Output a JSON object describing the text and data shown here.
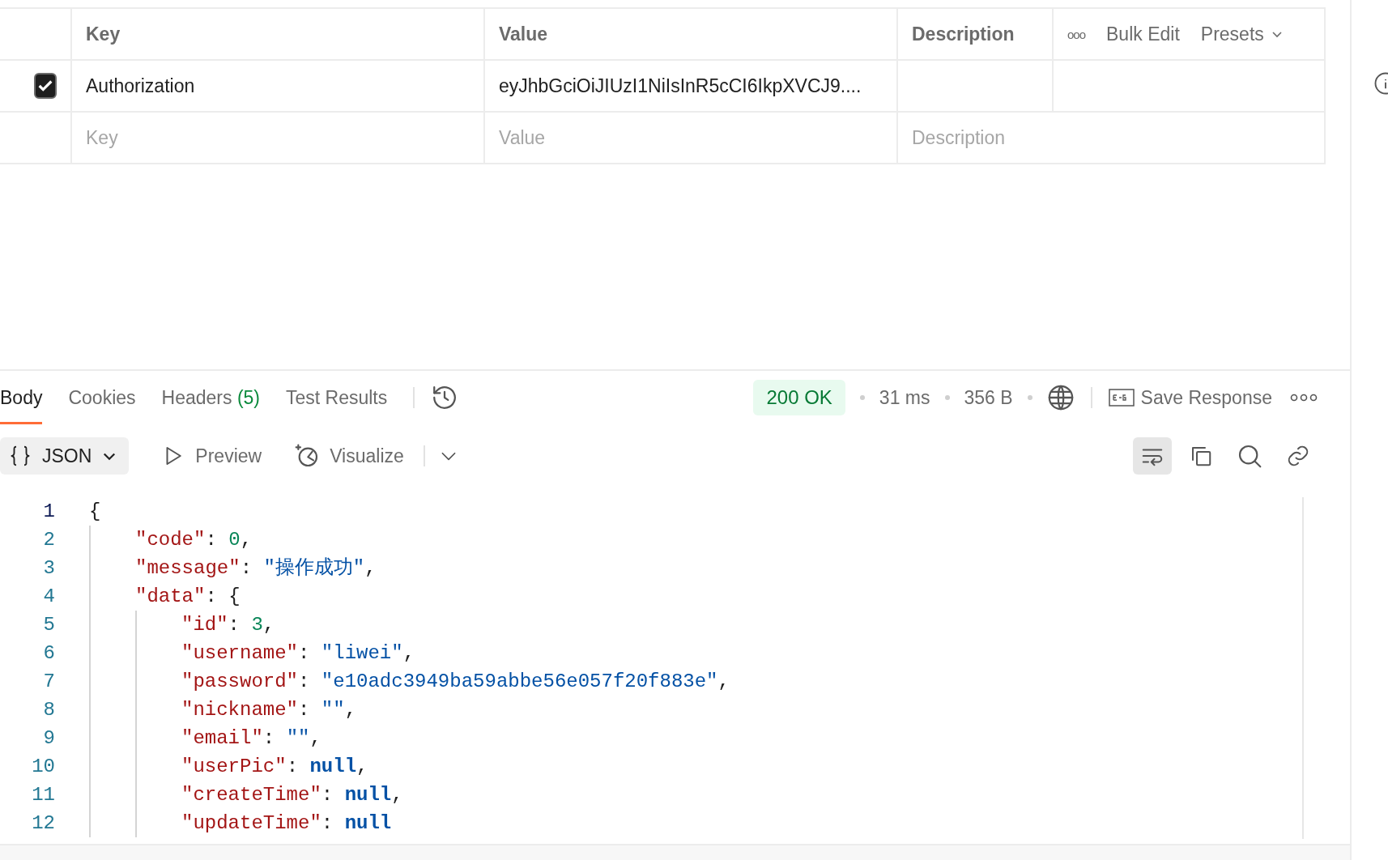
{
  "params_table": {
    "columns": [
      "Key",
      "Value",
      "Description"
    ],
    "actions": {
      "more": "ooo",
      "bulk_edit": "Bulk Edit",
      "presets": "Presets"
    },
    "rows": [
      {
        "checked": true,
        "key": "Authorization",
        "value": "eyJhbGciOiJIUzI1NiIsInR5cCI6IkpXVCJ9...."
      }
    ],
    "new_row": {
      "key_placeholder": "Key",
      "value_placeholder": "Value",
      "description_placeholder": "Description"
    }
  },
  "response": {
    "tabs": [
      {
        "label": "Body",
        "selected": true
      },
      {
        "label": "Cookies",
        "selected": false
      },
      {
        "label": "Headers",
        "count": "(5)",
        "selected": false
      },
      {
        "label": "Test Results",
        "selected": false
      }
    ],
    "status": "200 OK",
    "time": "31 ms",
    "size": "356 B",
    "save_label": "Save Response",
    "format": "JSON",
    "views": [
      {
        "kind": "preview",
        "label": "Preview"
      },
      {
        "kind": "visualize",
        "label": "Visualize"
      }
    ],
    "wrap_selected": true,
    "code": [
      {
        "number": "1",
        "tokens": [
          {
            "kind": "punct",
            "text": "{"
          }
        ],
        "children": [
          {
            "number": "2",
            "tokens": [
              {
                "kind": "key",
                "text": "\"code\""
              },
              {
                "kind": "punct",
                "text": ": "
              },
              {
                "kind": "number",
                "text": "0"
              },
              {
                "kind": "punct",
                "text": ","
              }
            ]
          },
          {
            "number": "3",
            "tokens": [
              {
                "kind": "key",
                "text": "\"message\""
              },
              {
                "kind": "punct",
                "text": ": "
              },
              {
                "kind": "string",
                "text": "\"操作成功\""
              },
              {
                "kind": "punct",
                "text": ","
              }
            ]
          },
          {
            "number": "4",
            "tokens": [
              {
                "kind": "key",
                "text": "\"data\""
              },
              {
                "kind": "punct",
                "text": ": {"
              }
            ],
            "children": [
              {
                "number": "5",
                "tokens": [
                  {
                    "kind": "key",
                    "text": "\"id\""
                  },
                  {
                    "kind": "punct",
                    "text": ": "
                  },
                  {
                    "kind": "number",
                    "text": "3"
                  },
                  {
                    "kind": "punct",
                    "text": ","
                  }
                ]
              },
              {
                "number": "6",
                "tokens": [
                  {
                    "kind": "key",
                    "text": "\"username\""
                  },
                  {
                    "kind": "punct",
                    "text": ": "
                  },
                  {
                    "kind": "string",
                    "text": "\"liwei\""
                  },
                  {
                    "kind": "punct",
                    "text": ","
                  }
                ]
              },
              {
                "number": "7",
                "tokens": [
                  {
                    "kind": "key",
                    "text": "\"password\""
                  },
                  {
                    "kind": "punct",
                    "text": ": "
                  },
                  {
                    "kind": "string",
                    "text": "\"e10adc3949ba59abbe56e057f20f883e\""
                  },
                  {
                    "kind": "punct",
                    "text": ","
                  }
                ]
              },
              {
                "number": "8",
                "tokens": [
                  {
                    "kind": "key",
                    "text": "\"nickname\""
                  },
                  {
                    "kind": "punct",
                    "text": ": "
                  },
                  {
                    "kind": "string",
                    "text": "\"\""
                  },
                  {
                    "kind": "punct",
                    "text": ","
                  }
                ]
              },
              {
                "number": "9",
                "tokens": [
                  {
                    "kind": "key",
                    "text": "\"email\""
                  },
                  {
                    "kind": "punct",
                    "text": ": "
                  },
                  {
                    "kind": "string",
                    "text": "\"\""
                  },
                  {
                    "kind": "punct",
                    "text": ","
                  }
                ]
              },
              {
                "number": "10",
                "tokens": [
                  {
                    "kind": "key",
                    "text": "\"userPic\""
                  },
                  {
                    "kind": "punct",
                    "text": ": "
                  },
                  {
                    "kind": "null",
                    "text": "null"
                  },
                  {
                    "kind": "punct",
                    "text": ","
                  }
                ]
              },
              {
                "number": "11",
                "tokens": [
                  {
                    "kind": "key",
                    "text": "\"createTime\""
                  },
                  {
                    "kind": "punct",
                    "text": ": "
                  },
                  {
                    "kind": "null",
                    "text": "null"
                  },
                  {
                    "kind": "punct",
                    "text": ","
                  }
                ]
              },
              {
                "number": "12",
                "tokens": [
                  {
                    "kind": "key",
                    "text": "\"updateTime\""
                  },
                  {
                    "kind": "punct",
                    "text": ": "
                  },
                  {
                    "kind": "null",
                    "text": "null"
                  }
                ]
              }
            ]
          }
        ]
      }
    ]
  }
}
